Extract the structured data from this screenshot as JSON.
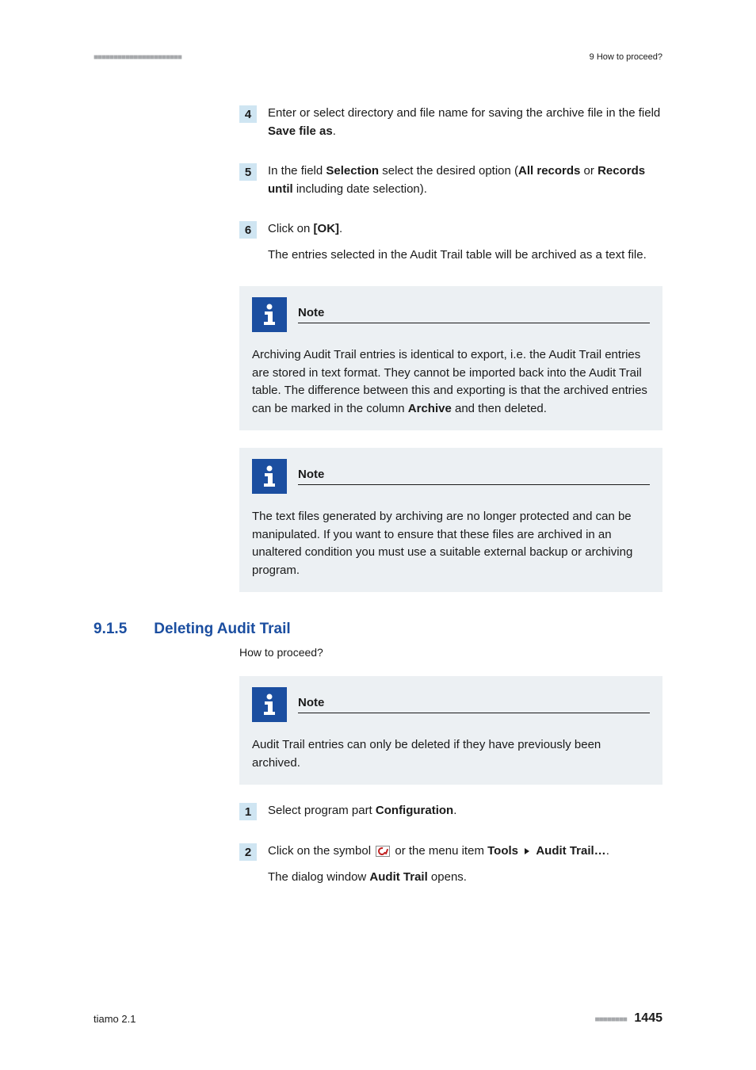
{
  "header": {
    "dots": "■■■■■■■■■■■■■■■■■■■■■■",
    "chapter": "9 How to proceed?"
  },
  "steps_a": [
    {
      "num": "4",
      "paras": [
        {
          "segments": [
            {
              "t": "Enter or select directory and file name for saving the archive file in the field "
            },
            {
              "t": "Save file as",
              "b": true
            },
            {
              "t": "."
            }
          ]
        }
      ]
    },
    {
      "num": "5",
      "paras": [
        {
          "segments": [
            {
              "t": "In the field "
            },
            {
              "t": "Selection",
              "b": true
            },
            {
              "t": " select the desired option ("
            },
            {
              "t": "All records",
              "b": true
            },
            {
              "t": " or "
            },
            {
              "t": "Records until",
              "b": true
            },
            {
              "t": " including date selection)."
            }
          ]
        }
      ]
    },
    {
      "num": "6",
      "paras": [
        {
          "segments": [
            {
              "t": "Click on "
            },
            {
              "t": "[OK]",
              "b": true
            },
            {
              "t": "."
            }
          ]
        },
        {
          "segments": [
            {
              "t": "The entries selected in the Audit Trail table will be archived as a text file."
            }
          ]
        }
      ]
    }
  ],
  "notes_a": [
    {
      "title": "Note",
      "segments": [
        {
          "t": "Archiving Audit Trail entries is identical to export, i.e. the Audit Trail entries are stored in text format. They cannot be imported back into the Audit Trail table. The difference between this and exporting is that the archived entries can be marked in the column "
        },
        {
          "t": "Archive",
          "b": true
        },
        {
          "t": " and then deleted."
        }
      ]
    },
    {
      "title": "Note",
      "segments": [
        {
          "t": "The text files generated by archiving are no longer protected and can be manipulated. If you want to ensure that these files are archived in an unaltered condition you must use a suitable external backup or archiving program."
        }
      ]
    }
  ],
  "section": {
    "num": "9.1.5",
    "title": "Deleting Audit Trail",
    "howto": "How to proceed?"
  },
  "notes_b": [
    {
      "title": "Note",
      "segments": [
        {
          "t": "Audit Trail entries can only be deleted if they have previously been archived."
        }
      ]
    }
  ],
  "steps_b": [
    {
      "num": "1",
      "paras": [
        {
          "segments": [
            {
              "t": "Select program part "
            },
            {
              "t": "Configuration",
              "b": true
            },
            {
              "t": "."
            }
          ]
        }
      ]
    },
    {
      "num": "2",
      "paras": [
        {
          "segments": [
            {
              "t": "Click on the symbol "
            },
            {
              "icon": "audit-trail-symbol"
            },
            {
              "t": " or the menu item "
            },
            {
              "t": "Tools",
              "b": true
            },
            {
              "t": " "
            },
            {
              "tri": true
            },
            {
              "t": " "
            },
            {
              "t": "Audit Trail…",
              "b": true
            },
            {
              "t": "."
            }
          ]
        },
        {
          "segments": [
            {
              "t": "The dialog window "
            },
            {
              "t": "Audit Trail",
              "b": true
            },
            {
              "t": " opens."
            }
          ]
        }
      ]
    }
  ],
  "footer": {
    "product": "tiamo 2.1",
    "dots": "■■■■■■■■",
    "page": "1445"
  }
}
